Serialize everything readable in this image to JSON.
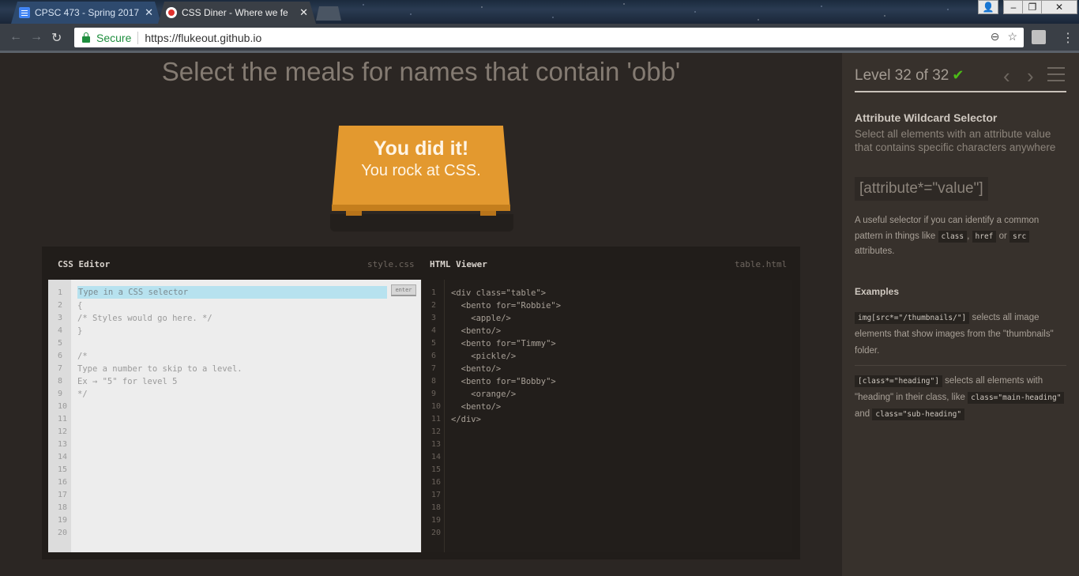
{
  "browser": {
    "tabs": [
      {
        "label": "CPSC 473 - Spring 2017 -"
      },
      {
        "label": "CSS Diner - Where we fe"
      }
    ],
    "secure_label": "Secure",
    "url": "https://flukeout.github.io"
  },
  "page": {
    "instruction": "Select the meals for names that contain 'obb'",
    "plate": {
      "line1": "You did it!",
      "line2": "You rock at CSS."
    }
  },
  "css_editor": {
    "title": "CSS Editor",
    "filename": "style.css",
    "placeholder": "Type in a CSS selector",
    "enter_label": "enter",
    "code_lines": [
      "{",
      "/* Styles would go here. */",
      "}",
      "",
      "/*",
      "Type a number to skip to a level.",
      "Ex → \"5\" for level 5",
      "*/"
    ],
    "line_count": 20
  },
  "html_viewer": {
    "title": "HTML Viewer",
    "filename": "table.html",
    "code_lines": [
      "<div class=\"table\">",
      "  <bento for=\"Robbie\">",
      "    <apple/>",
      "  <bento/>",
      "  <bento for=\"Timmy\">",
      "    <pickle/>",
      "  <bento/>",
      "  <bento for=\"Bobby\">",
      "    <orange/>",
      "  <bento/>",
      "</div>"
    ],
    "line_count": 20
  },
  "sidebar": {
    "level_label": "Level 32 of 32",
    "progress": 1.0,
    "selector_name": "Attribute Wildcard Selector",
    "selector_desc": "Select all elements with an attribute value that contains specific characters anywhere",
    "syntax": "[attribute*=\"value\"]",
    "hint_before": "A useful selector if you can identify a common pattern in things like",
    "hint_code1": "class",
    "hint_code2": "href",
    "hint_or": "or",
    "hint_code3": "src",
    "hint_after": "attributes.",
    "examples_title": "Examples",
    "ex1_code": "img[src*=\"/thumbnails/\"]",
    "ex1_text": "selects all image elements that show images from the \"thumbnails\" folder.",
    "ex2_code": "[class*=\"heading\"]",
    "ex2_text": "selects all elements with \"heading\" in their class, like",
    "ex2_code2": "class=\"main-heading\"",
    "ex2_and": "and",
    "ex2_code3": "class=\"sub-heading\""
  },
  "colors": {
    "accent": "#e3992f",
    "check": "#4cbb17",
    "selection": "#b7e2ef"
  }
}
